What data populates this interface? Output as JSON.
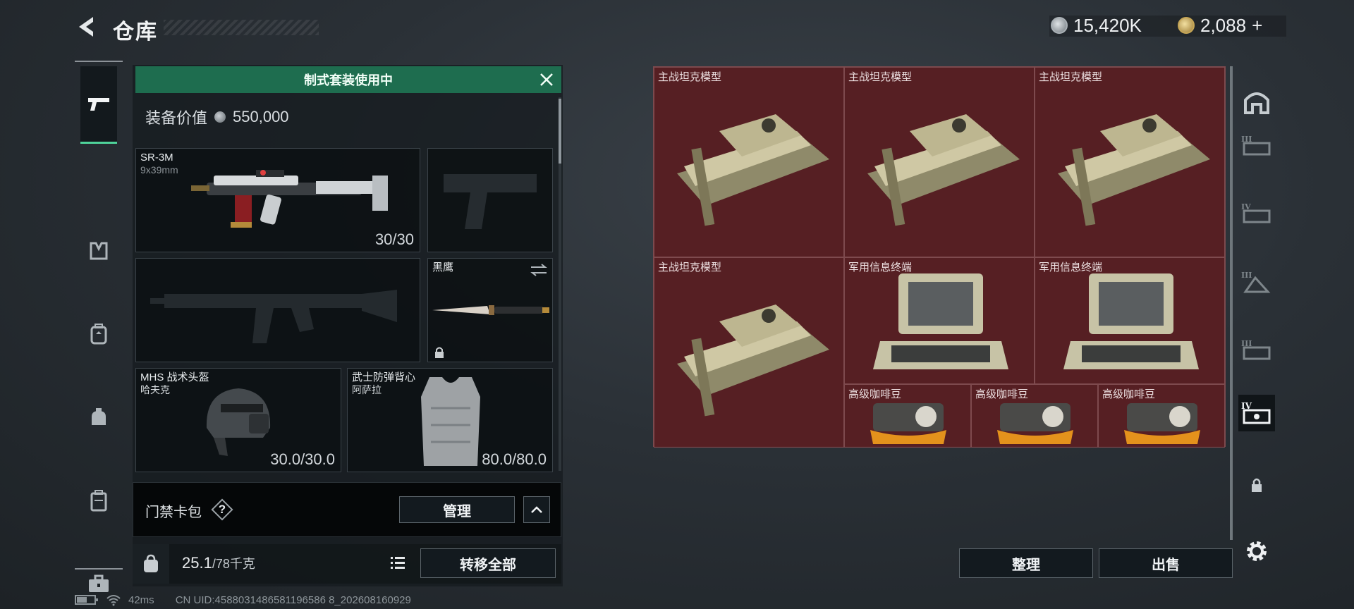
{
  "header": {
    "title": "仓库"
  },
  "currency": {
    "silver": "15,420K",
    "gold": "2,088",
    "gold_plus": "+"
  },
  "loadout": {
    "banner": "制式套装使用中",
    "equip_value_label": "装备价值",
    "equip_value": "550,000",
    "primary": {
      "name": "SR-3M",
      "caliber": "9x39mm",
      "ammo": "30/30"
    },
    "melee": {
      "name": "黑鹰"
    },
    "helmet": {
      "name": "MHS 战术头盔",
      "sub": "哈夫克",
      "durability": "30.0/30.0"
    },
    "armor": {
      "name": "武士防弹背心",
      "sub": "阿萨拉",
      "durability": "80.0/80.0"
    }
  },
  "keycard": {
    "label": "门禁卡包",
    "help": "?",
    "manage": "管理"
  },
  "weight": {
    "current": "25.1",
    "max": "/78千克",
    "transfer_all": "转移全部"
  },
  "status": {
    "ping": "42ms",
    "uid": "CN UID:4588031486581196586 8_202608160929"
  },
  "storage": {
    "items": [
      {
        "label": "主战坦克模型",
        "icon": "tank-model-icon"
      },
      {
        "label": "主战坦克模型",
        "icon": "tank-model-icon"
      },
      {
        "label": "主战坦克模型",
        "icon": "tank-model-icon"
      },
      {
        "label": "主战坦克模型",
        "icon": "tank-model-icon"
      },
      {
        "label": "军用信息终端",
        "icon": "military-terminal-icon"
      },
      {
        "label": "军用信息终端",
        "icon": "military-terminal-icon"
      },
      {
        "label": "高级咖啡豆",
        "icon": "coffee-beans-icon"
      },
      {
        "label": "高级咖啡豆",
        "icon": "coffee-beans-icon"
      },
      {
        "label": "高级咖啡豆",
        "icon": "coffee-beans-icon"
      }
    ],
    "sort": "整理",
    "sell": "出售"
  },
  "colors": {
    "accent_green": "#1e6d4f",
    "grid_red": "#561f24",
    "active_underline": "#4fd39a"
  }
}
